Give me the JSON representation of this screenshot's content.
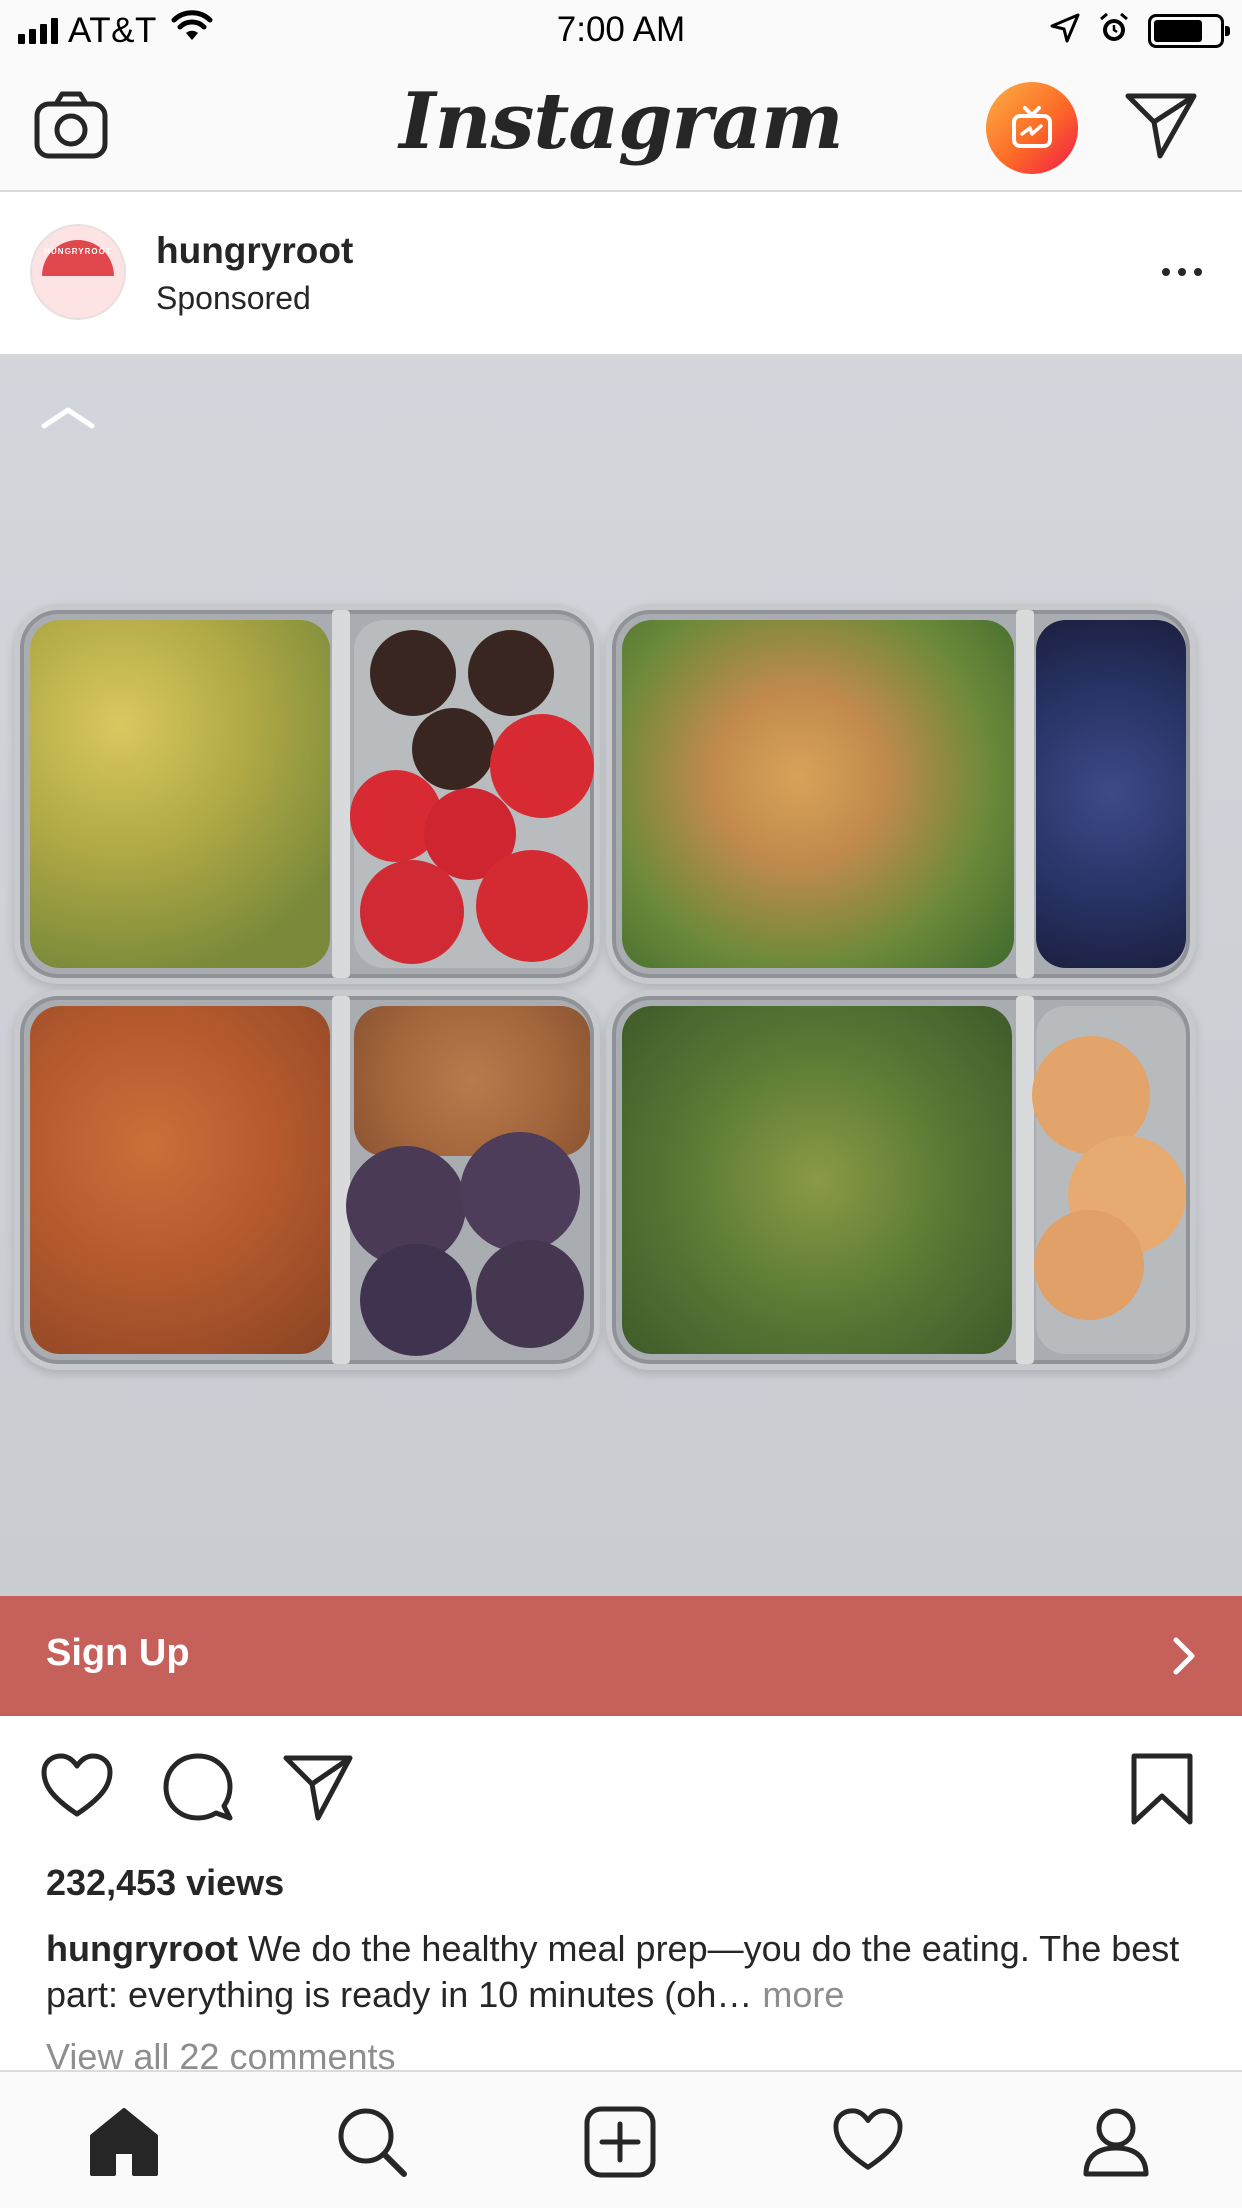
{
  "status_bar": {
    "carrier": "AT&T",
    "time": "7:00 AM",
    "battery_level": 0.75
  },
  "nav": {
    "logo": "Instagram",
    "icons": [
      "camera-icon",
      "igtv-icon",
      "direct-message-icon"
    ]
  },
  "post": {
    "username": "hungryroot",
    "sponsored_label": "Sponsored",
    "avatar_text": "HUNGRYROOT",
    "cta_label": "Sign Up",
    "views": "232,453 views",
    "caption_user": "hungryroot",
    "caption_text": " We do the healthy meal prep—you do the eating. The best part: everything is ready in 10 minutes (oh… ",
    "caption_more": "more",
    "view_comments": "View all 22 comments"
  },
  "tabs": [
    "home-icon",
    "search-icon",
    "new-post-icon",
    "activity-icon",
    "profile-icon"
  ],
  "colors": {
    "cta": "#c5605a",
    "igtv_start": "#fcb045",
    "igtv_end": "#f2194a",
    "text": "#262626",
    "muted": "#8e8e8e"
  }
}
